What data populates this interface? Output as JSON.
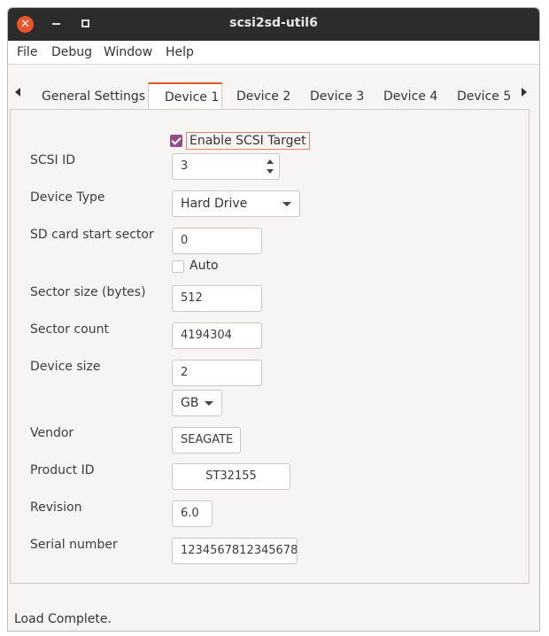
{
  "window": {
    "title": "scsi2sd-util6"
  },
  "menu": [
    "File",
    "Debug",
    "Window",
    "Help"
  ],
  "tabs": [
    "General Settings",
    "Device 1",
    "Device 2",
    "Device 3",
    "Device 4",
    "Device 5"
  ],
  "active_tab": "Device 1",
  "device": {
    "enable_label": "Enable SCSI Target",
    "enable_checked": true,
    "scsi_id_label": "SCSI ID",
    "scsi_id": "3",
    "device_type_label": "Device Type",
    "device_type": "Hard Drive",
    "start_sector_label": "SD card start sector",
    "start_sector": "0",
    "auto_label": "Auto",
    "auto_checked": false,
    "sector_size_label": "Sector size (bytes)",
    "sector_size": "512",
    "sector_count_label": "Sector count",
    "sector_count": "4194304",
    "device_size_label": "Device size",
    "device_size": "2",
    "size_unit": "GB",
    "vendor_label": "Vendor",
    "vendor": "SEAGATE",
    "product_id_label": "Product ID",
    "product_id": "ST32155",
    "revision_label": "Revision",
    "revision": "6.0",
    "serial_label": "Serial number",
    "serial": "1234567812345678"
  },
  "status": "Load Complete.",
  "colors": {
    "titlebar": "#2c2c2c",
    "close": "#e9542b",
    "accent": "#e95420",
    "checkbox": "#924d8b"
  }
}
